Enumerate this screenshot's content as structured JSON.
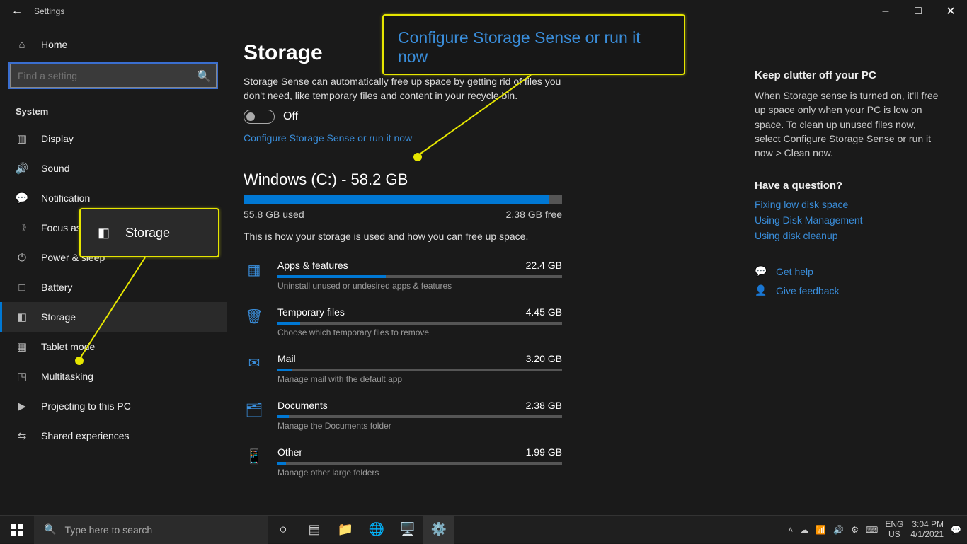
{
  "window": {
    "title": "Settings"
  },
  "sidebar": {
    "home": "Home",
    "search_placeholder": "Find a setting",
    "section": "System",
    "items": [
      {
        "label": "Display"
      },
      {
        "label": "Sound"
      },
      {
        "label": "Notification"
      },
      {
        "label": "Focus assist"
      },
      {
        "label": "Power & sleep"
      },
      {
        "label": "Battery"
      },
      {
        "label": "Storage",
        "active": true
      },
      {
        "label": "Tablet mode"
      },
      {
        "label": "Multitasking"
      },
      {
        "label": "Projecting to this PC"
      },
      {
        "label": "Shared experiences"
      }
    ]
  },
  "page": {
    "title": "Storage",
    "sense_desc": "Storage Sense can automatically free up space by getting rid of files you don't need, like temporary files and content in your recycle bin.",
    "toggle_state": "Off",
    "configure_link": "Configure Storage Sense or run it now",
    "drive_title": "Windows (C:) - 58.2 GB",
    "drive_fill_pct": 96,
    "used_label": "55.8 GB used",
    "free_label": "2.38 GB free",
    "usage_desc": "This is how your storage is used and how you can free up space.",
    "categories": [
      {
        "name": "Apps & features",
        "size": "22.4 GB",
        "pct": 38,
        "desc": "Uninstall unused or undesired apps & features"
      },
      {
        "name": "Temporary files",
        "size": "4.45 GB",
        "pct": 8,
        "desc": "Choose which temporary files to remove"
      },
      {
        "name": "Mail",
        "size": "3.20 GB",
        "pct": 5,
        "desc": "Manage mail with the default app"
      },
      {
        "name": "Documents",
        "size": "2.38 GB",
        "pct": 4,
        "desc": "Manage the Documents folder"
      },
      {
        "name": "Other",
        "size": "1.99 GB",
        "pct": 3,
        "desc": "Manage other large folders"
      }
    ]
  },
  "side": {
    "h1": "Keep clutter off your PC",
    "p1": "When Storage sense is turned on, it'll free up space only when your PC is low on space. To clean up unused files now, select Configure Storage Sense or run it now > Clean now.",
    "h2": "Have a question?",
    "faq": [
      "Fixing low disk space",
      "Using Disk Management",
      "Using disk cleanup"
    ],
    "help": "Get help",
    "feedback": "Give feedback"
  },
  "callout": {
    "big": "Configure Storage Sense or run it now",
    "box": "Storage"
  },
  "taskbar": {
    "search_placeholder": "Type here to search",
    "lang1": "ENG",
    "lang2": "US",
    "time": "3:04 PM",
    "date": "4/1/2021"
  }
}
